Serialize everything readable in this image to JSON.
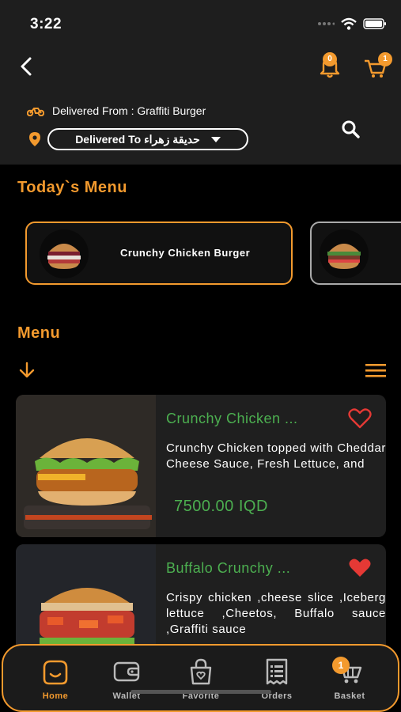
{
  "status": {
    "time": "3:22"
  },
  "header": {
    "notification_count": "0",
    "cart_count": "1",
    "delivered_from": "Delivered From : Graffiti Burger",
    "delivered_to": "Delivered To حديقة زهراء"
  },
  "today": {
    "title": "Today`s Menu",
    "items": [
      {
        "label": "Crunchy Chicken Burger"
      }
    ]
  },
  "menu": {
    "title": "Menu",
    "products": [
      {
        "name": "Crunchy Chicken ...",
        "description": "Crunchy Chicken topped with Cheddar Cheese Sauce, Fresh Lettuce, and",
        "price": "7500.00 IQD",
        "favorite": false
      },
      {
        "name": "Buffalo Crunchy ...",
        "description": "Crispy chicken ,cheese slice ,Iceberg lettuce ,Cheetos, Buffalo sauce ,Graffiti sauce",
        "favorite": true
      }
    ]
  },
  "nav": {
    "items": [
      {
        "label": "Home",
        "icon": "home-icon",
        "active": true
      },
      {
        "label": "Wallet",
        "icon": "wallet-icon"
      },
      {
        "label": "Favorite",
        "icon": "favorite-bag-icon"
      },
      {
        "label": "Orders",
        "icon": "orders-icon"
      },
      {
        "label": "Basket",
        "icon": "basket-icon"
      }
    ],
    "basket_count": "1"
  },
  "colors": {
    "accent": "#f39a2e",
    "price_green": "#4caf50",
    "favorite_red": "#e53935"
  }
}
